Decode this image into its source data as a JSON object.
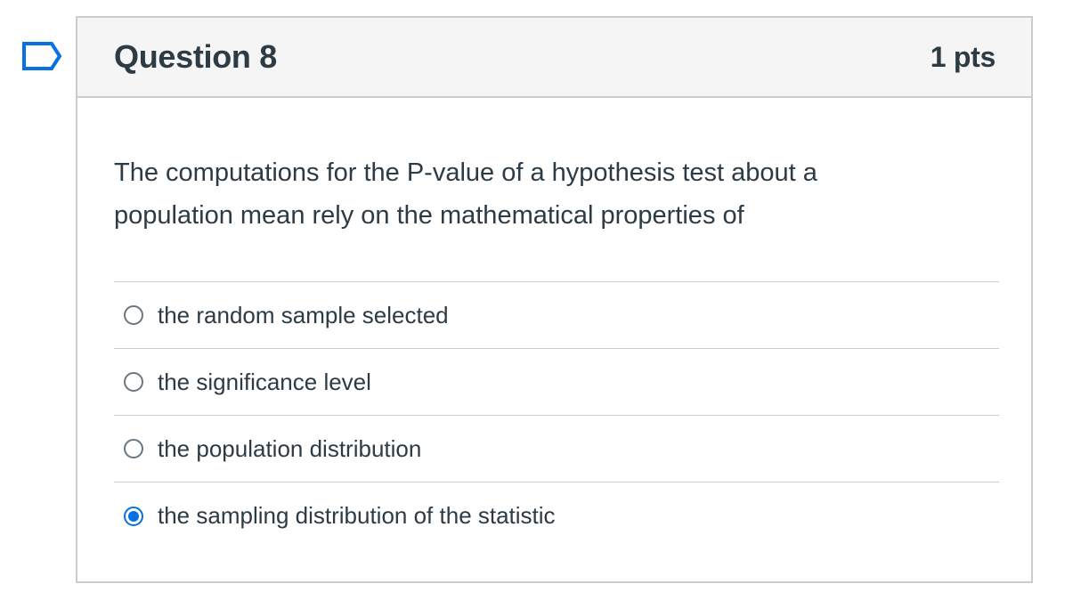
{
  "question": {
    "title": "Question 8",
    "points": "1 pts",
    "text": "The computations for the P-value of a hypothesis test about a population mean rely on the mathematical properties of"
  },
  "answers": [
    {
      "label": "the random sample selected",
      "selected": false
    },
    {
      "label": "the significance level",
      "selected": false
    },
    {
      "label": "the population distribution",
      "selected": false
    },
    {
      "label": "the sampling distribution of the statistic",
      "selected": true
    }
  ],
  "colors": {
    "accent": "#0770e3",
    "text": "#2d3b45",
    "border": "#c7cdd1",
    "header_bg": "#f5f5f5"
  },
  "icons": {
    "flag": "bookmark-flag-icon"
  }
}
